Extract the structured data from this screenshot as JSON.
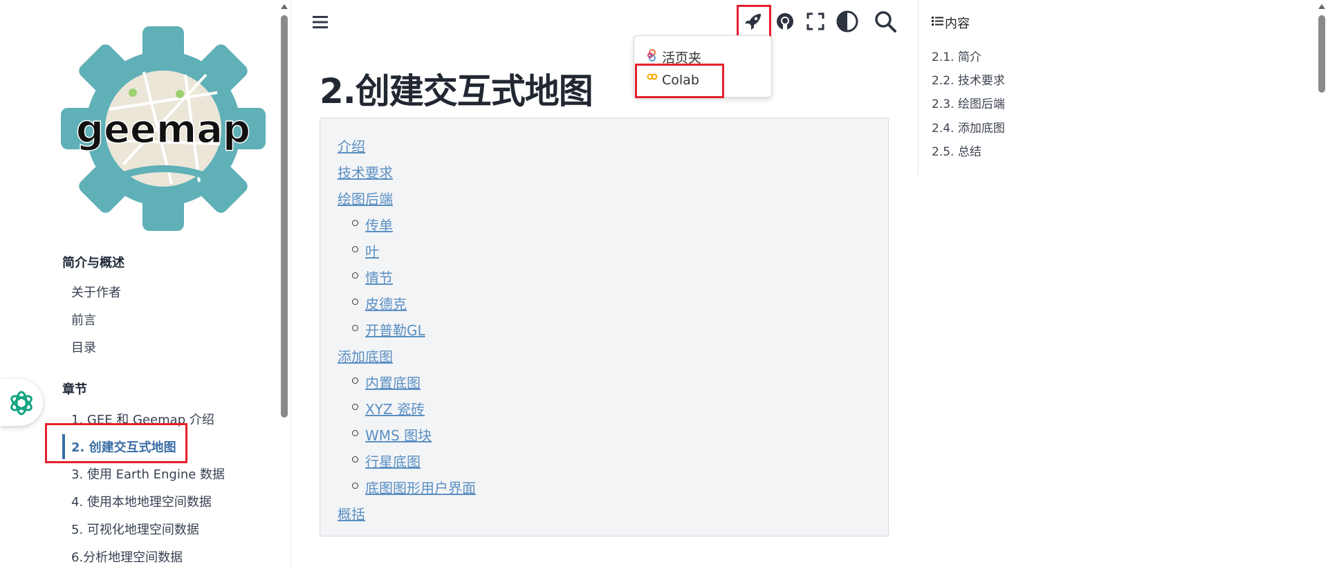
{
  "colors": {
    "accent": "#3a6ea5",
    "link": "#5a8fc3",
    "highlight_box": "#e5202a",
    "logo_teal": "#5fb0b7"
  },
  "sidebar": {
    "logo_text": "geemap",
    "sections": [
      {
        "caption": "简介与概述",
        "items": [
          "关于作者",
          "前言",
          "目录"
        ]
      },
      {
        "caption": "章节",
        "items": [
          "1. GEE 和 Geemap 介绍",
          "2. 创建交互式地图",
          "3. 使用 Earth Engine 数据",
          "4. 使用本地地理空间数据",
          "5. 可视化地理空间数据",
          "6.分析地理空间数据"
        ]
      }
    ],
    "active_item": "2. 创建交互式地图"
  },
  "header": {
    "icons": [
      "menu-icon",
      "rocket-icon",
      "github-icon",
      "fullscreen-icon",
      "theme-toggle-icon",
      "search-icon"
    ],
    "launch_menu": {
      "items": [
        {
          "label": "活页夹",
          "icon": "binder-icon"
        },
        {
          "label": "Colab",
          "icon": "colab-icon"
        }
      ]
    }
  },
  "main": {
    "title": "2.创建交互式地图",
    "toc": [
      {
        "label": "介绍",
        "children": []
      },
      {
        "label": "技术要求",
        "children": []
      },
      {
        "label": "绘图后端",
        "children": [
          "传单",
          "叶",
          "情节",
          "皮德克",
          "开普勒GL"
        ]
      },
      {
        "label": "添加底图",
        "children": [
          "内置底图",
          "XYZ 瓷砖",
          "WMS 图块",
          "行星底图",
          "底图图形用户界面"
        ]
      },
      {
        "label": "概括",
        "children": []
      }
    ]
  },
  "right_toc": {
    "header": "内容",
    "items": [
      "2.1. 简介",
      "2.2. 技术要求",
      "2.3. 绘图后端",
      "2.4. 添加底图",
      "2.5. 总结"
    ]
  }
}
